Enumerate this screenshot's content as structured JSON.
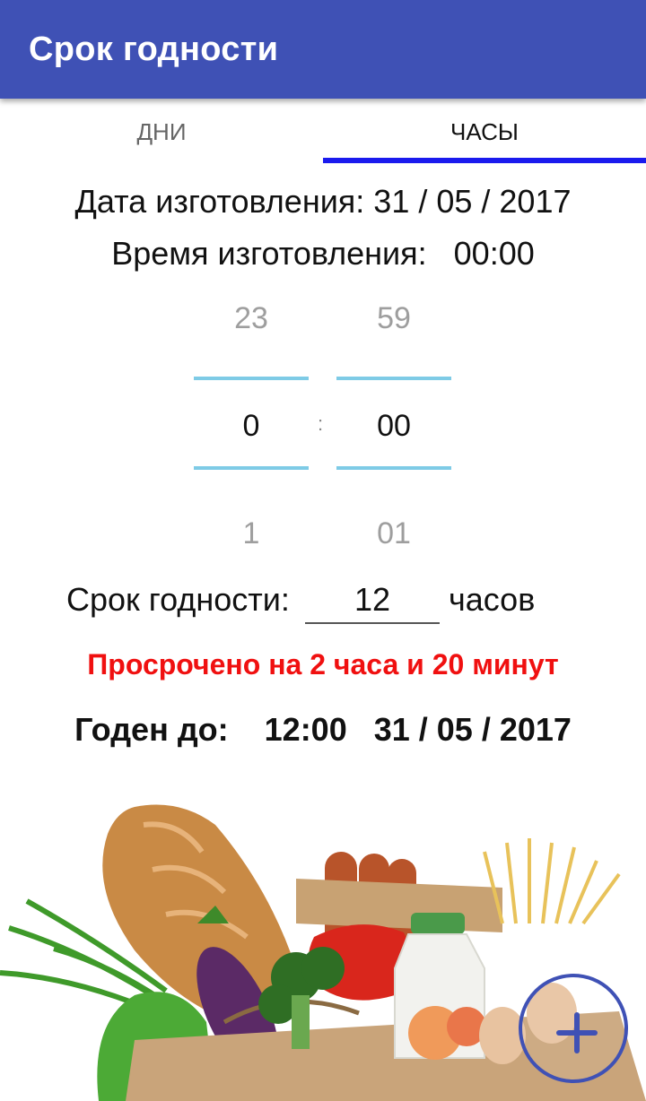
{
  "app_bar": {
    "title": "Срок годности"
  },
  "tabs": [
    {
      "label": "ДНИ",
      "selected": false
    },
    {
      "label": "ЧАСЫ",
      "selected": true
    }
  ],
  "manufacture": {
    "date_text": "Дата изготовления: 31 / 05 / 2017",
    "time_text": "Время изготовления:   00:00"
  },
  "time_picker": {
    "hours": {
      "prev": "23",
      "current": "0",
      "next": "1"
    },
    "minutes": {
      "prev": "59",
      "current": "00",
      "next": "01"
    },
    "separator": ":"
  },
  "shelf_life": {
    "label": "Срок годности:",
    "value": "12",
    "unit": "часов"
  },
  "status": {
    "expired_text": "Просрочено на 2 часа и 20 минут",
    "color": "#f01010"
  },
  "valid_until": {
    "text": "Годен до:    12:00   31 / 05 / 2017"
  },
  "fab": {
    "icon": "plus-icon"
  },
  "colors": {
    "primary": "#3f51b5",
    "tab_indicator": "#1a1aee",
    "picker_divider": "#7ecbe6"
  }
}
